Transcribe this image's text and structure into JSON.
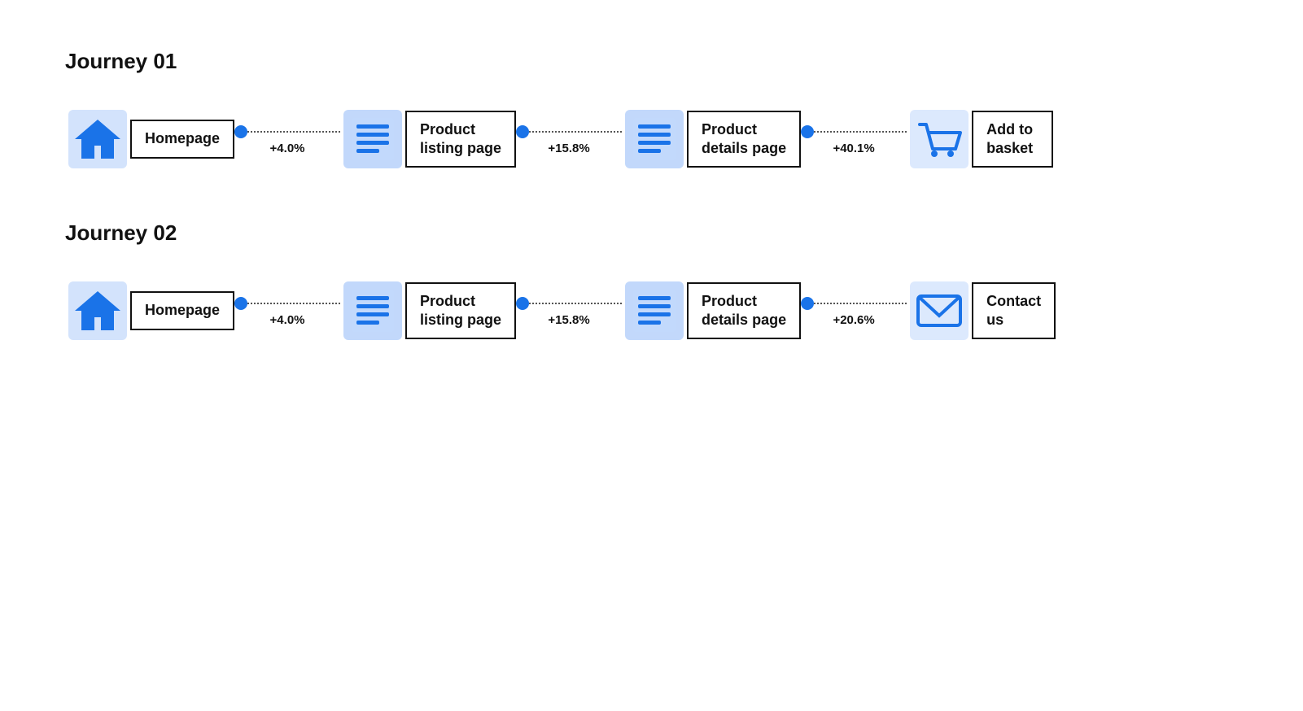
{
  "journeys": [
    {
      "id": "journey-01",
      "title": "Journey 01",
      "nodes": [
        {
          "id": "home1",
          "icon": "home",
          "label": "Homepage"
        },
        {
          "id": "listing1",
          "icon": "listing",
          "label": "Product\nlisting page"
        },
        {
          "id": "details1",
          "icon": "details",
          "label": "Product\ndetails page"
        },
        {
          "id": "basket1",
          "icon": "basket",
          "label": "Add to\nbasket"
        }
      ],
      "connectors": [
        {
          "pct": "+4.0%"
        },
        {
          "pct": "+15.8%"
        },
        {
          "pct": "+40.1%"
        }
      ]
    },
    {
      "id": "journey-02",
      "title": "Journey 02",
      "nodes": [
        {
          "id": "home2",
          "icon": "home",
          "label": "Homepage"
        },
        {
          "id": "listing2",
          "icon": "listing",
          "label": "Product\nlisting page"
        },
        {
          "id": "details2",
          "icon": "details",
          "label": "Product\ndetails page"
        },
        {
          "id": "contact2",
          "icon": "contact",
          "label": "Contact\nus"
        }
      ],
      "connectors": [
        {
          "pct": "+4.0%"
        },
        {
          "pct": "+15.8%"
        },
        {
          "pct": "+20.6%"
        }
      ]
    }
  ]
}
